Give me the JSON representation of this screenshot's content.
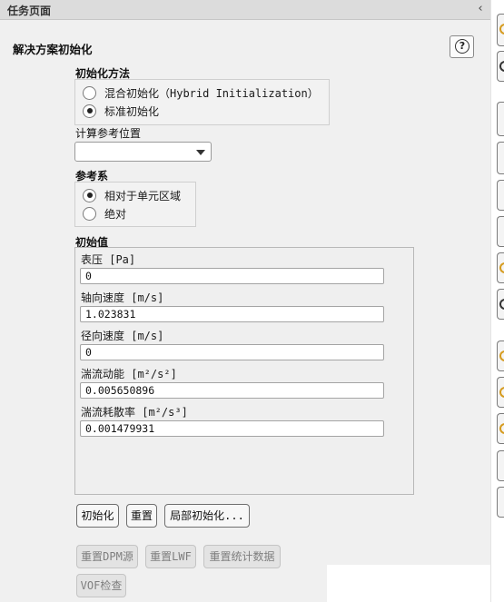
{
  "window": {
    "title": "任务页面"
  },
  "section": {
    "title": "解决方案初始化",
    "help_symbol": "?"
  },
  "init_method": {
    "label": "初始化方法",
    "options": [
      {
        "label": "混合初始化（Hybrid Initialization）",
        "selected": false
      },
      {
        "label": "标准初始化",
        "selected": true
      }
    ]
  },
  "compute_from": {
    "label": "计算参考位置",
    "selected_value": ""
  },
  "reference_frame": {
    "label": "参考系",
    "options": [
      {
        "label": "相对于单元区域",
        "selected": true
      },
      {
        "label": "绝对",
        "selected": false
      }
    ]
  },
  "initial_values": {
    "label": "初始值",
    "fields": [
      {
        "label": "表压 [Pa]",
        "value": "0"
      },
      {
        "label": "轴向速度 [m/s]",
        "value": "1.023831"
      },
      {
        "label": "径向速度 [m/s]",
        "value": "0"
      },
      {
        "label": "湍流动能 [m²/s²]",
        "value": "0.005650896"
      },
      {
        "label": "湍流耗散率 [m²/s³]",
        "value": "0.001479931"
      }
    ]
  },
  "buttons": {
    "initialize": "初始化",
    "reset": "重置",
    "patch": "局部初始化...",
    "reset_dpm": "重置DPM源",
    "reset_lwf": "重置LWF",
    "reset_stats": "重置统计数据",
    "vof_check": "VOF检查"
  },
  "icons": {
    "collapse": "chevron-left-icon",
    "help": "help-icon"
  },
  "colors": {
    "panel_background": "#f0f0f0",
    "title_bar": "#dcdcdc",
    "toolbar_accent": "#d69b1e"
  }
}
